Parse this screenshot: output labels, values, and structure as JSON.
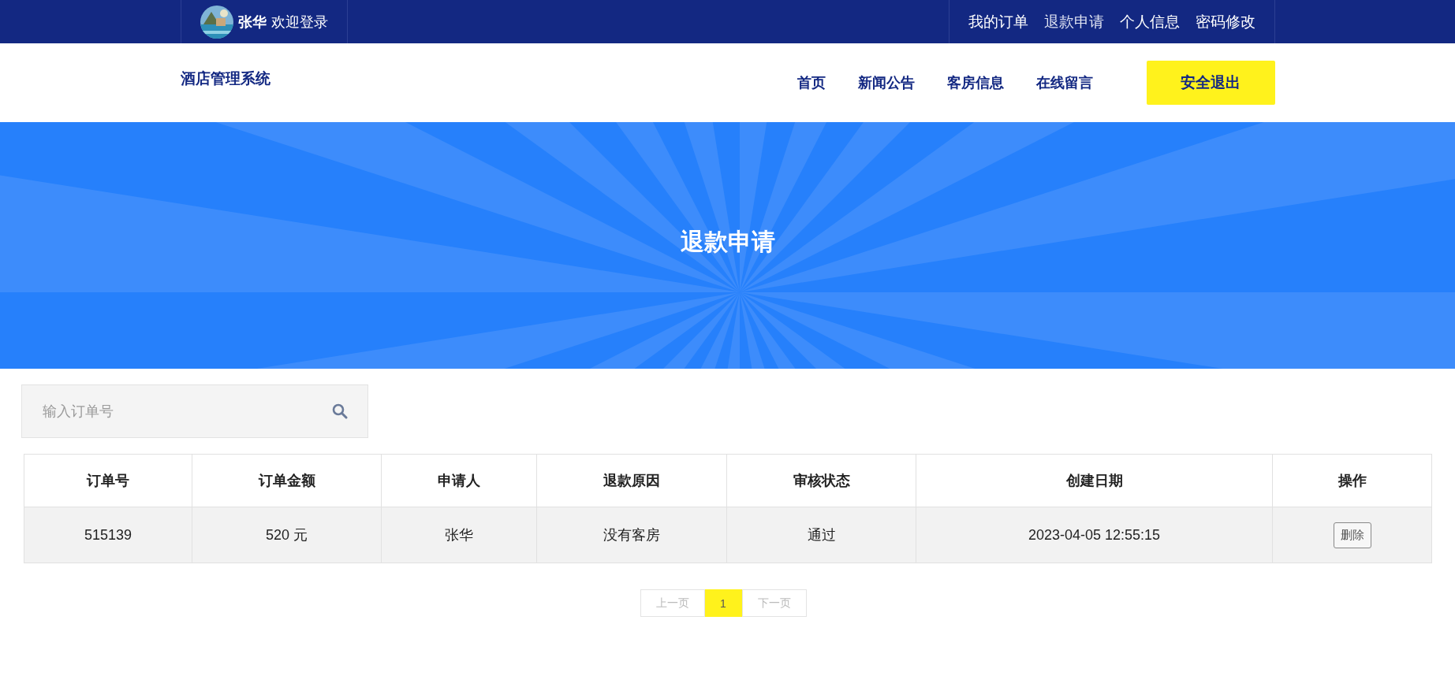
{
  "top_bar": {
    "user_name": "张华",
    "welcome": "欢迎登录",
    "links": [
      {
        "label": "我的订单",
        "selected": false
      },
      {
        "label": "退款申请",
        "selected": true
      },
      {
        "label": "个人信息",
        "selected": false
      },
      {
        "label": "密码修改",
        "selected": false
      }
    ]
  },
  "header": {
    "brand": "酒店管理系统",
    "nav": [
      "首页",
      "新闻公告",
      "客房信息",
      "在线留言"
    ],
    "logout": "安全退出"
  },
  "banner": {
    "title": "退款申请"
  },
  "search": {
    "placeholder": "输入订单号"
  },
  "table": {
    "columns": [
      "订单号",
      "订单金额",
      "申请人",
      "退款原因",
      "审核状态",
      "创建日期",
      "操作"
    ],
    "rows": [
      {
        "cells": [
          "515139",
          "520 元",
          "张华",
          "没有客房",
          "通过",
          "2023-04-05 12:55:15"
        ],
        "action": "删除"
      }
    ]
  },
  "pagination": {
    "prev": "上一页",
    "pages": [
      {
        "label": "1",
        "selected": true
      }
    ],
    "next": "下一页"
  }
}
